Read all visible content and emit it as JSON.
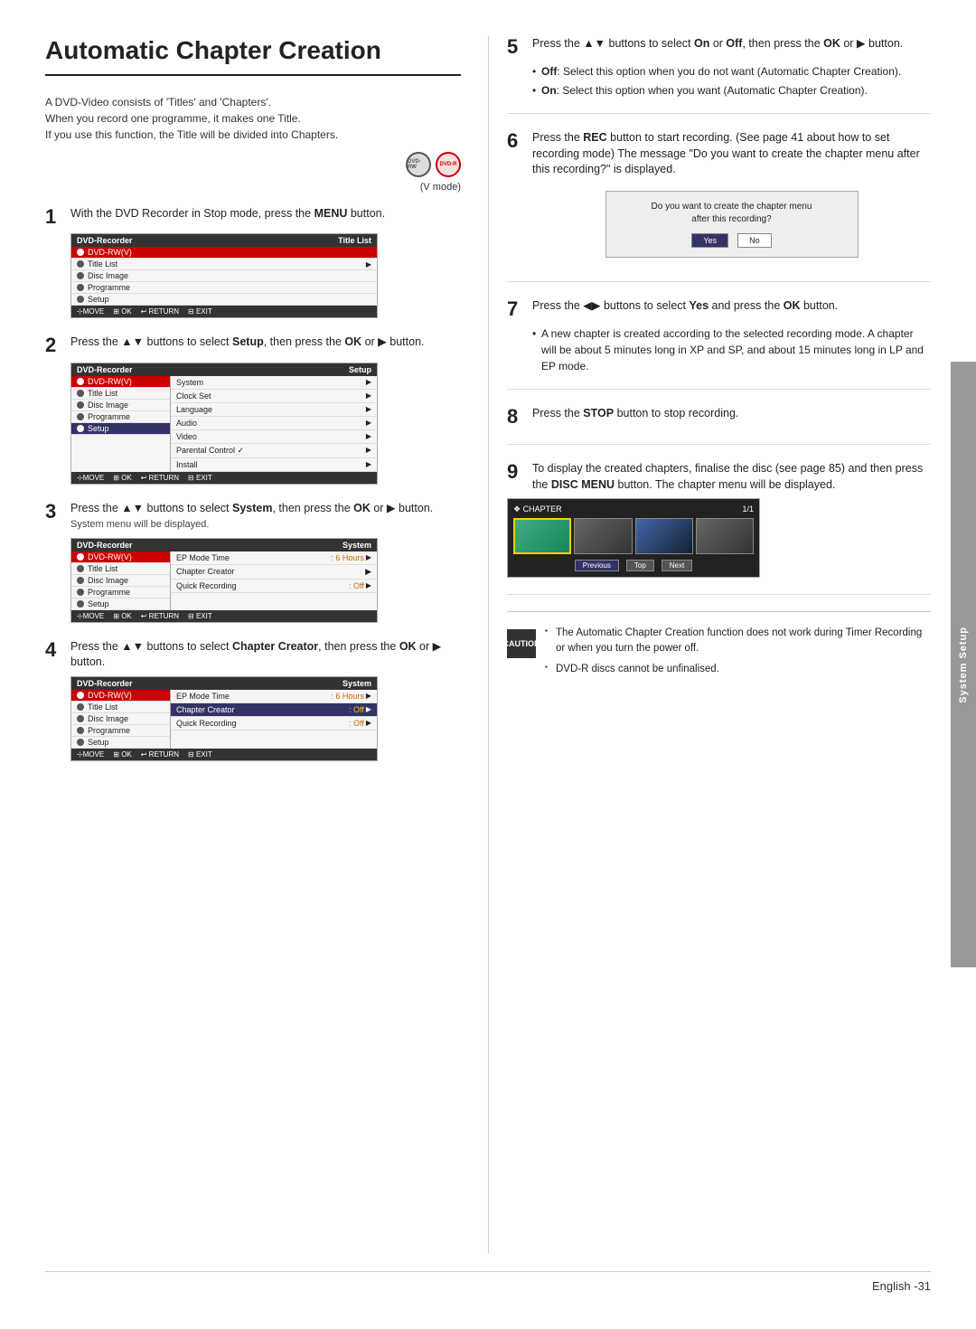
{
  "page": {
    "title": "Automatic Chapter Creation",
    "footer": "English -31"
  },
  "intro": {
    "text": "A DVD-Video consists of 'Titles' and 'Chapters'.\nWhen you record one programme, it makes one Title.\nIf you use this function, the Title will be divided into Chapters."
  },
  "vmode": "(V mode)",
  "system_setup_tab": "System Setup",
  "steps": [
    {
      "number": "1",
      "text": "With the DVD Recorder in Stop mode, press the MENU button.",
      "ui": {
        "title_left": "DVD-Recorder",
        "title_right": "Title List",
        "menu_items": [
          {
            "label": "DVD-RW(V)",
            "highlighted": true
          },
          {
            "label": "Title List",
            "arrow": true,
            "selected": false
          },
          {
            "label": "Disc Image",
            "arrow": false
          },
          {
            "label": "Programme",
            "arrow": false
          },
          {
            "label": "Setup",
            "arrow": false
          }
        ]
      }
    },
    {
      "number": "2",
      "text": "Press the ▲▼ buttons to select Setup, then press the OK or ▶ button.",
      "ui": {
        "title_left": "DVD-Recorder",
        "title_right": "Setup",
        "menu_items": [
          {
            "label": "DVD-RW(V)",
            "highlighted": true
          },
          {
            "label": "Title List",
            "arrow": false
          },
          {
            "label": "Disc Image",
            "arrow": false
          },
          {
            "label": "Programme",
            "arrow": false
          },
          {
            "label": "Setup",
            "arrow": false,
            "selected": true
          }
        ],
        "submenu": [
          {
            "label": "System",
            "arrow": true
          },
          {
            "label": "Clock Set",
            "arrow": true
          },
          {
            "label": "Language",
            "arrow": true
          },
          {
            "label": "Audio",
            "arrow": true
          },
          {
            "label": "Video",
            "arrow": true
          },
          {
            "label": "Parental Control ✓",
            "arrow": true
          },
          {
            "label": "Install",
            "arrow": true
          }
        ]
      }
    },
    {
      "number": "3",
      "text": "Press the ▲▼ buttons to select System, then press the OK or ▶ button.",
      "sub_text": "System menu will be displayed.",
      "ui": {
        "title_left": "DVD-Recorder",
        "title_right": "System",
        "menu_items": [
          {
            "label": "DVD-RW(V)",
            "highlighted": true
          },
          {
            "label": "Title List",
            "arrow": false
          },
          {
            "label": "Disc Image",
            "arrow": false
          },
          {
            "label": "Programme",
            "arrow": false
          },
          {
            "label": "Setup",
            "arrow": false
          }
        ],
        "system_items": [
          {
            "label": "EP Mode Time",
            "value": ": 6 Hours",
            "arrow": true
          },
          {
            "label": "Chapter Creator",
            "value": "",
            "arrow": true,
            "selected": false
          },
          {
            "label": "Quick Recording",
            "value": ": Off",
            "arrow": true
          }
        ]
      }
    },
    {
      "number": "4",
      "text": "Press the ▲▼ buttons to select Chapter Creator, then press the OK or ▶ button.",
      "ui": {
        "title_left": "DVD-Recorder",
        "title_right": "System",
        "menu_items": [
          {
            "label": "DVD-RW(V)",
            "highlighted": true
          },
          {
            "label": "Title List",
            "arrow": false
          },
          {
            "label": "Disc Image",
            "arrow": false
          },
          {
            "label": "Programme",
            "arrow": false
          },
          {
            "label": "Setup",
            "arrow": false
          }
        ],
        "system_items": [
          {
            "label": "EP Mode Time",
            "value": ": 6 Hours",
            "arrow": true
          },
          {
            "label": "Chapter Creator",
            "value": ": Off",
            "arrow": true,
            "selected": true
          },
          {
            "label": "Quick Recording",
            "value": ": Off",
            "arrow": true
          }
        ]
      }
    }
  ],
  "right_steps": [
    {
      "number": "5",
      "text": "Press the ▲▼ buttons to select On or Off, then press the OK or ▶ button.",
      "bullets": [
        "Off: Select this option when you do not want (Automatic Chapter Creation).",
        "On: Select this option when you want (Automatic Chapter Creation)."
      ]
    },
    {
      "number": "6",
      "text": "Press the REC button to start recording. (See page 41 about how to set recording mode) The message \"Do you want to create the chapter menu after this recording?\" is displayed.",
      "dialog": {
        "text": "Do you want to create the chapter menu after this recording?",
        "btn_yes": "Yes",
        "btn_no": "No"
      }
    },
    {
      "number": "7",
      "text": "Press the ◀▶ buttons to select Yes and press the OK button.",
      "sub_bullets": [
        "A new chapter is created according to the selected recording mode. A chapter will be about 5 minutes long in XP and SP, and about 15 minutes long in LP and EP mode."
      ]
    },
    {
      "number": "8",
      "text": "Press the STOP button to stop recording."
    },
    {
      "number": "9",
      "text": "To display the created chapters, finalise the disc (see page 85) and then press the DISC MENU button. The chapter menu will be displayed.",
      "chapter_grid": {
        "header_left": "❖ CHAPTER",
        "header_right": "1/1",
        "nav_buttons": [
          "Previous",
          "Top",
          "Next"
        ]
      }
    }
  ],
  "caution": {
    "label": "CAUTION",
    "items": [
      "The Automatic Chapter Creation function does not work during Timer Recording or when you turn the power off.",
      "DVD-R discs cannot be unfinalised."
    ]
  }
}
